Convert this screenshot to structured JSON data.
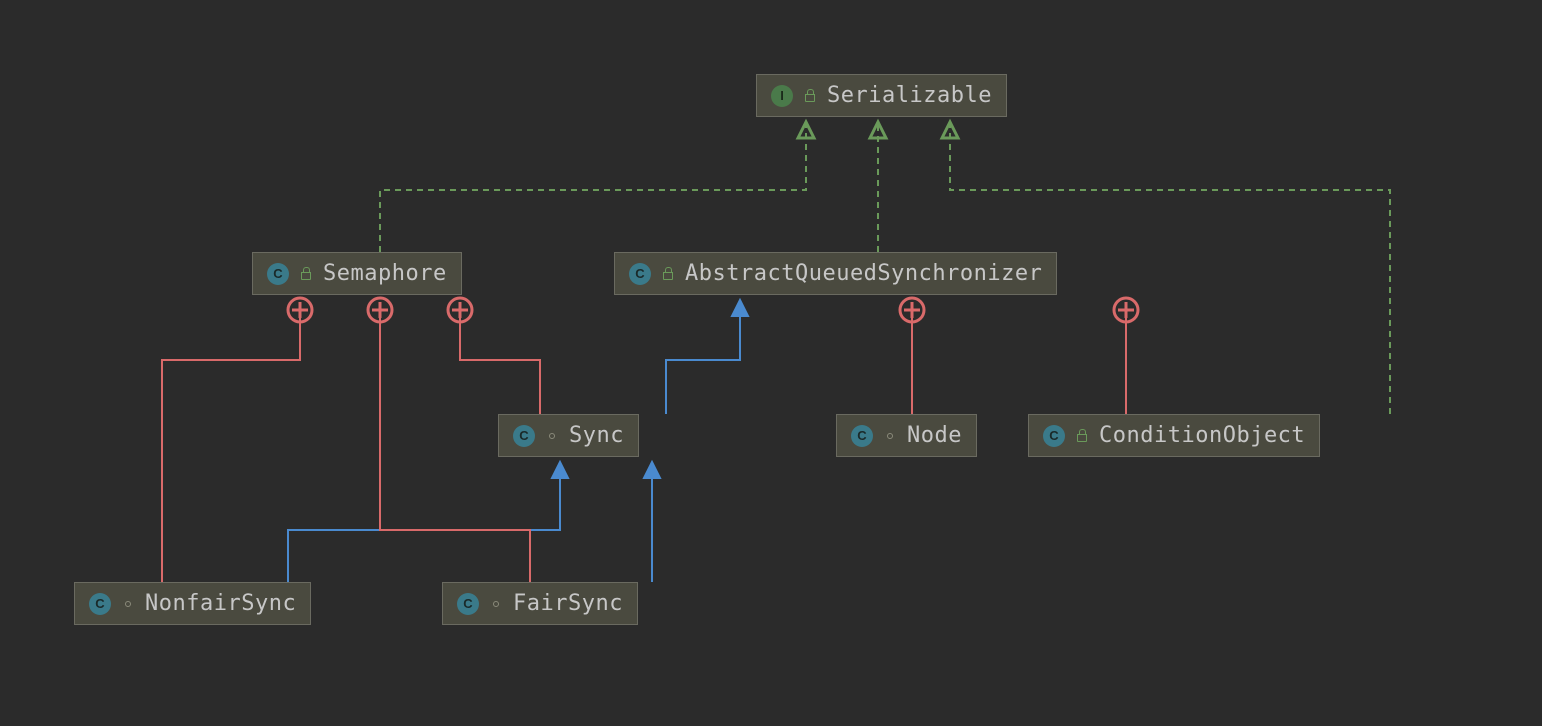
{
  "nodes": {
    "serializable": {
      "label": "Serializable",
      "type": "I",
      "visibility": "public"
    },
    "semaphore": {
      "label": "Semaphore",
      "type": "C",
      "visibility": "public"
    },
    "aqs": {
      "label": "AbstractQueuedSynchronizer",
      "type": "C",
      "visibility": "public"
    },
    "sync": {
      "label": "Sync",
      "type": "C",
      "visibility": "package"
    },
    "node": {
      "label": "Node",
      "type": "C",
      "visibility": "package"
    },
    "conditionObject": {
      "label": "ConditionObject",
      "type": "C",
      "visibility": "public"
    },
    "nonfairSync": {
      "label": "NonfairSync",
      "type": "C",
      "visibility": "package"
    },
    "fairSync": {
      "label": "FairSync",
      "type": "C",
      "visibility": "package"
    }
  },
  "colors": {
    "implements": "#6a9a5a",
    "extends": "#4a8acf",
    "inner": "#d96a6a",
    "bg": "#2b2b2b",
    "nodeBg": "#4a4a3f",
    "text": "#c7c7c7"
  },
  "relationships": [
    {
      "from": "semaphore",
      "to": "serializable",
      "kind": "implements"
    },
    {
      "from": "aqs",
      "to": "serializable",
      "kind": "implements"
    },
    {
      "from": "conditionObject",
      "to": "serializable",
      "kind": "implements"
    },
    {
      "from": "sync",
      "to": "aqs",
      "kind": "extends"
    },
    {
      "from": "nonfairSync",
      "to": "sync",
      "kind": "extends"
    },
    {
      "from": "fairSync",
      "to": "sync",
      "kind": "extends"
    },
    {
      "from": "nonfairSync",
      "to": "semaphore",
      "kind": "inner"
    },
    {
      "from": "fairSync",
      "to": "semaphore",
      "kind": "inner"
    },
    {
      "from": "sync",
      "to": "semaphore",
      "kind": "inner"
    },
    {
      "from": "node",
      "to": "aqs",
      "kind": "inner"
    },
    {
      "from": "conditionObject",
      "to": "aqs",
      "kind": "inner"
    }
  ]
}
